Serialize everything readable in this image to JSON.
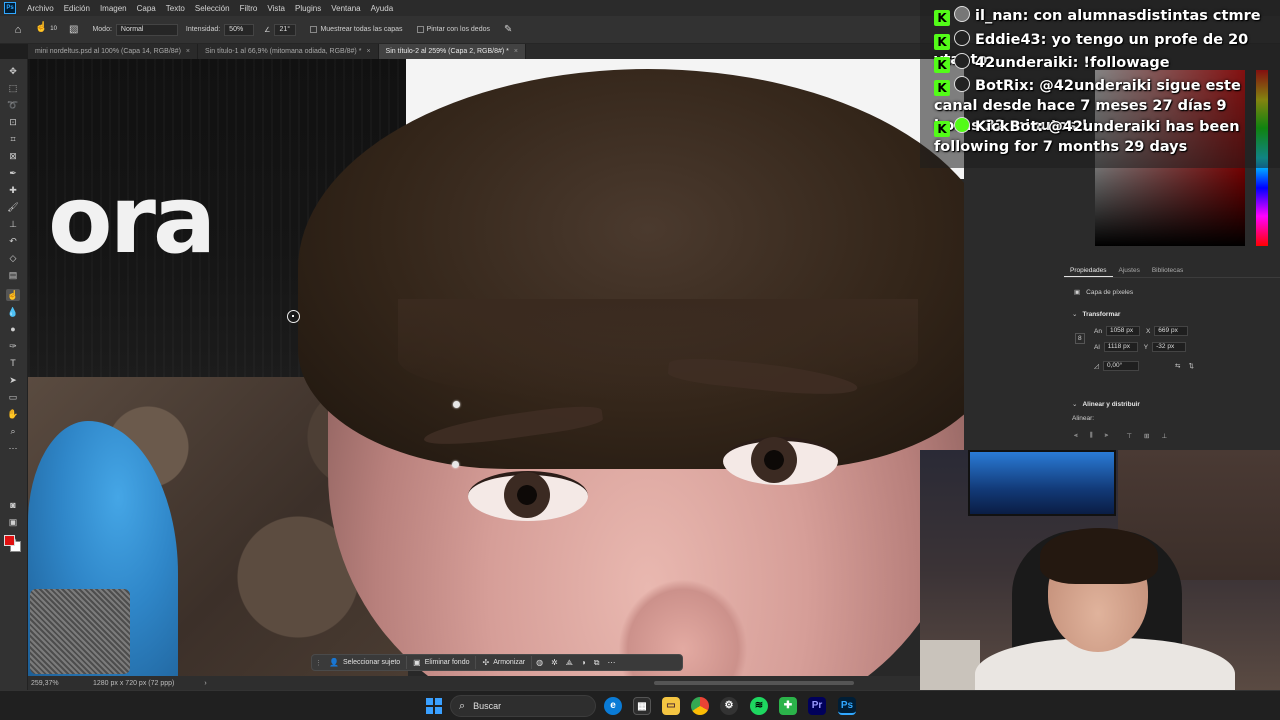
{
  "menubar": {
    "items": [
      "Archivo",
      "Edición",
      "Imagen",
      "Capa",
      "Texto",
      "Selección",
      "Filtro",
      "Vista",
      "Plugins",
      "Ventana",
      "Ayuda"
    ]
  },
  "options": {
    "brush_size": "10",
    "mode_label": "Modo:",
    "mode_value": "Normal",
    "intensity_label": "Intensidad:",
    "intensity_value": "50%",
    "angle_value": "21°",
    "sample_all_label": "Muestrear todas las capas",
    "finger_paint_label": "Pintar con los dedos"
  },
  "tabs": [
    {
      "label": "mini nordeltus.psd al 100% (Capa 14, RGB/8#)",
      "active": false
    },
    {
      "label": "Sin título-1 al 66,9% (mitomana odiada, RGB/8#) *",
      "active": false
    },
    {
      "label": "Sin título-2 al 259% (Capa 2, RGB/8#) *",
      "active": true
    }
  ],
  "canvas": {
    "big_text": "ora"
  },
  "context_bar": {
    "select_subject": "Seleccionar sujeto",
    "remove_bg": "Eliminar fondo",
    "harmonize": "Armonizar"
  },
  "status": {
    "zoom": "259,37%",
    "doc_size": "1280 px x 720 px (72 ppp)"
  },
  "properties": {
    "tabs": [
      "Propiedades",
      "Ajustes",
      "Bibliotecas"
    ],
    "layer_type": "Capa de píxeles",
    "transform_label": "Transformar",
    "width_label": "An",
    "width_value": "1058 px",
    "x_label": "X",
    "x_value": "669 px",
    "height_label": "Al",
    "height_value": "1118 px",
    "y_label": "Y",
    "y_value": "-32 px",
    "angle_value": "0,00°",
    "align_label": "Alinear y distribuir",
    "align_sub": "Alinear:"
  },
  "chat": [
    {
      "user": "il_nan",
      "message": "con alumnasdistintas ctmre"
    },
    {
      "user": "Eddie43",
      "message": "yo tengo un profe de 20 ytanto"
    },
    {
      "user": "42underaiki",
      "message": "!followage"
    },
    {
      "user": "BotRix",
      "message": "@42underaiki sigue este canal desde hace 7 meses 27 días 9 horas 32 minutos !"
    },
    {
      "user": "KickBot",
      "message": "@42underaiki has been following for 7 months 29 days"
    }
  ],
  "taskbar": {
    "search_placeholder": "Buscar"
  },
  "colors": {
    "foreground": "#e01010",
    "background": "#ffffff",
    "kick_green": "#53fc18",
    "ps_blue": "#31a8ff"
  }
}
